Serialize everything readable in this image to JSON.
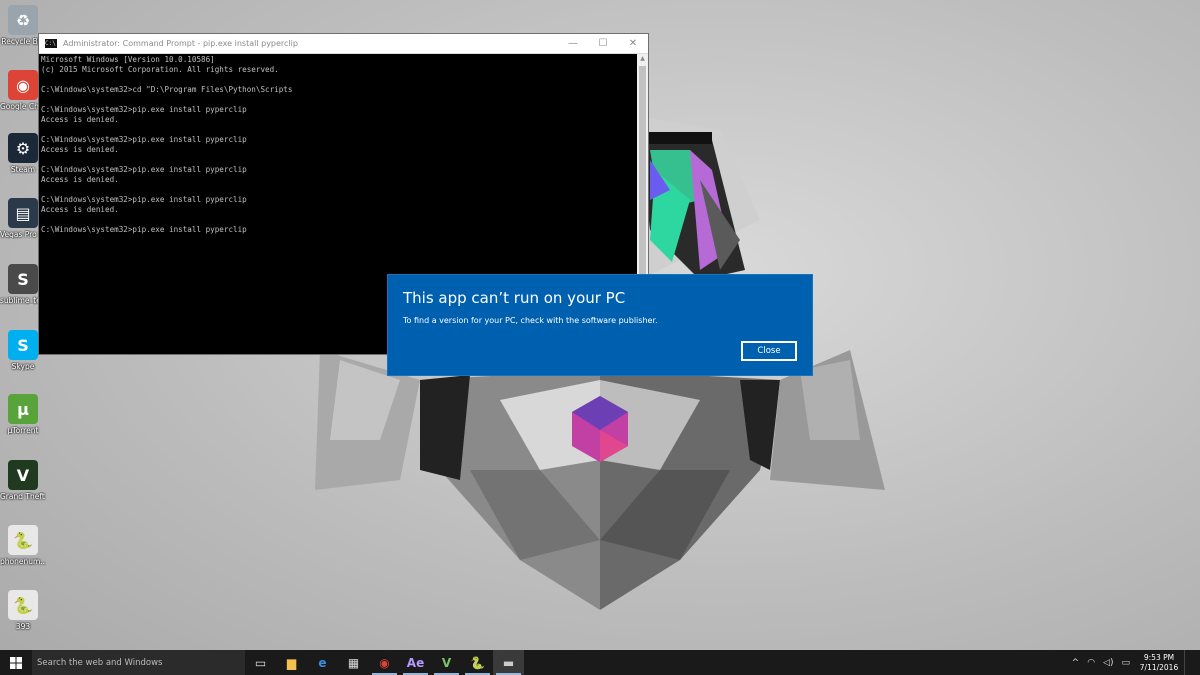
{
  "desktop": {
    "icons": [
      {
        "label": "Recycle Bin",
        "glyph": "♻",
        "color": "#9aa4ad"
      },
      {
        "label": "Google Chrome",
        "glyph": "◉",
        "color": "#db4437"
      },
      {
        "label": "Steam",
        "glyph": "⚙",
        "color": "#1b2838"
      },
      {
        "label": "Vegas Pro 13.0 (64-bit)",
        "glyph": "▤",
        "color": "#2b3a4a"
      },
      {
        "label": "sublime_text - Shortcut",
        "glyph": "S",
        "color": "#4a4a4a"
      },
      {
        "label": "Skype",
        "glyph": "S",
        "color": "#00aff0"
      },
      {
        "label": "µTorrent",
        "glyph": "µ",
        "color": "#58a33a"
      },
      {
        "label": "Grand Theft Auto V",
        "glyph": "V",
        "color": "#1f3a1f"
      },
      {
        "label": "phonenum...",
        "glyph": "🐍",
        "color": "#e8e8e8"
      },
      {
        "label": "393",
        "glyph": "🐍",
        "color": "#e8e8e8"
      }
    ]
  },
  "cmd": {
    "title": "Administrator: Command Prompt - pip.exe  install pyperclip",
    "minimize": "—",
    "maximize": "☐",
    "close": "✕",
    "output": "Microsoft Windows [Version 10.0.10586]\n(c) 2015 Microsoft Corporation. All rights reserved.\n\nC:\\Windows\\system32>cd \"D:\\Program Files\\Python\\Scripts\n\nC:\\Windows\\system32>pip.exe install pyperclip\nAccess is denied.\n\nC:\\Windows\\system32>pip.exe install pyperclip\nAccess is denied.\n\nC:\\Windows\\system32>pip.exe install pyperclip\nAccess is denied.\n\nC:\\Windows\\system32>pip.exe install pyperclip\nAccess is denied.\n\nC:\\Windows\\system32>pip.exe install pyperclip"
  },
  "dialog": {
    "title": "This app can’t run on your PC",
    "message": "To find a version for your PC, check with the software publisher.",
    "close_label": "Close",
    "bg_color": "#0060b0"
  },
  "taskbar": {
    "search_placeholder": "Search the web and Windows",
    "items": [
      {
        "name": "task-view-icon",
        "glyph": "▭",
        "color": "#ddd"
      },
      {
        "name": "file-explorer-icon",
        "glyph": "▆",
        "color": "#f2c14e"
      },
      {
        "name": "edge-icon",
        "glyph": "e",
        "color": "#3a8de0"
      },
      {
        "name": "store-icon",
        "glyph": "▦",
        "color": "#ddd"
      },
      {
        "name": "chrome-icon",
        "glyph": "◉",
        "color": "#db4437"
      },
      {
        "name": "after-effects-icon",
        "glyph": "Ae",
        "color": "#b49bff"
      },
      {
        "name": "gta-icon",
        "glyph": "V",
        "color": "#7cc46a"
      },
      {
        "name": "python-file-icon",
        "glyph": "🐍",
        "color": "#ddd"
      },
      {
        "name": "cmd-icon",
        "glyph": "▬",
        "color": "#ccc"
      }
    ],
    "tray": {
      "up_arrow": "^",
      "wifi": "◠",
      "volume": "◁)",
      "message": "▭"
    },
    "clock_time": "9:53 PM",
    "clock_date": "7/11/2016"
  }
}
